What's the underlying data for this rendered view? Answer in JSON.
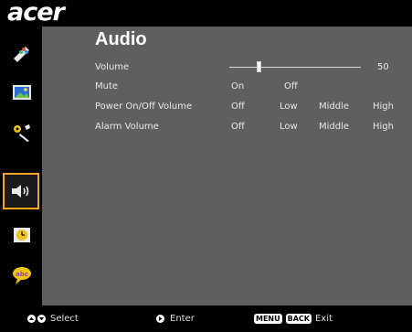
{
  "brand": {
    "logo_text": "acer"
  },
  "page": {
    "title": "Audio"
  },
  "settings": {
    "volume": {
      "label": "Volume",
      "value": "50",
      "level": 0.5
    },
    "mute": {
      "label": "Mute",
      "options": [
        "On",
        "Off"
      ]
    },
    "power_volume": {
      "label": "Power On/Off Volume",
      "options": [
        "Off",
        "Low",
        "Middle",
        "High"
      ]
    },
    "alarm_volume": {
      "label": "Alarm Volume",
      "options": [
        "Off",
        "Low",
        "Middle",
        "High"
      ]
    }
  },
  "sidebar": {
    "items": [
      {
        "icon": "color-icon"
      },
      {
        "icon": "image-icon"
      },
      {
        "icon": "settings-icon"
      },
      {
        "icon": "audio-icon",
        "active": true
      },
      {
        "icon": "timer-icon"
      },
      {
        "icon": "language-icon"
      }
    ]
  },
  "footer": {
    "select_label": "Select",
    "enter_label": "Enter",
    "menu_key": "MENU",
    "back_key": "BACK",
    "exit_label": "Exit"
  },
  "colors": {
    "panel": "#5f5f5f",
    "highlight": "#f5a623",
    "text": "#e8e8e8"
  }
}
